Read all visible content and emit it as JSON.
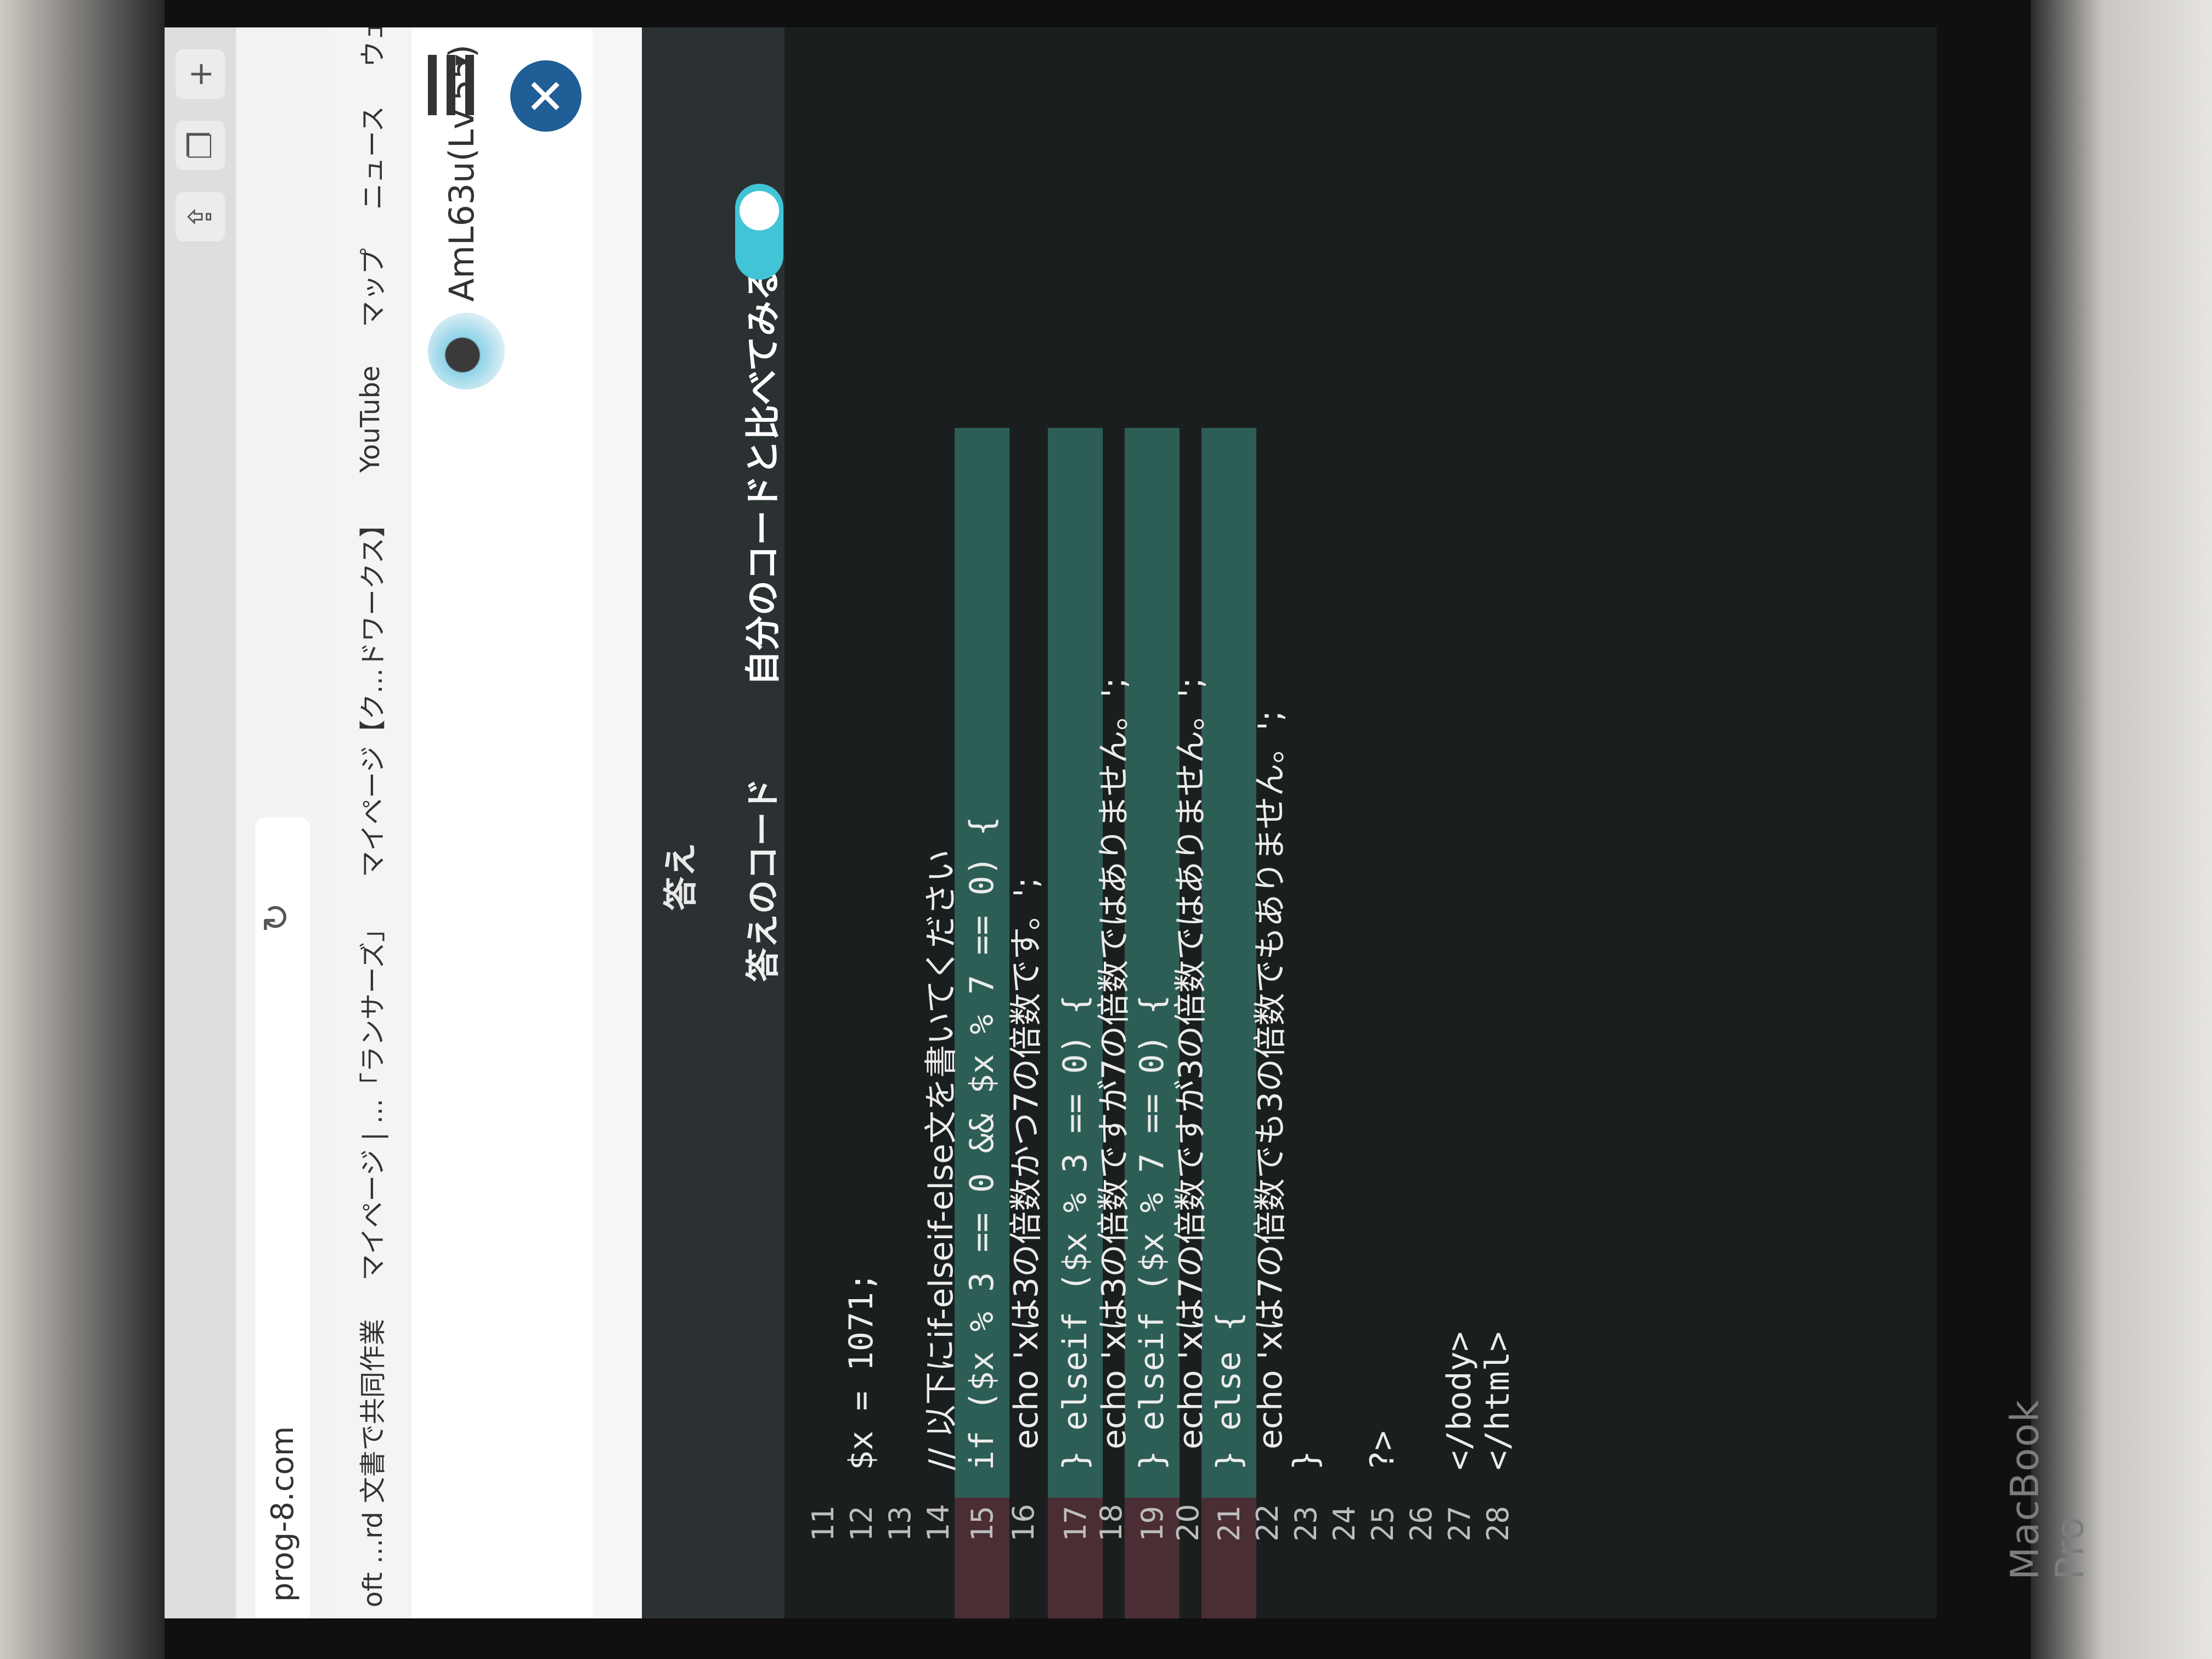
{
  "browser": {
    "url": "prog-8.com",
    "bookmarks": [
      "oft ...rd 文書で共同作業",
      "マイページ | ...「ランサーズ」",
      "マイページ【ク...ドワークス】",
      "YouTube",
      "マップ",
      "ニュース",
      "ウェブストア"
    ],
    "more_bookmarks": ">>",
    "new_tab": "+"
  },
  "header": {
    "user_name": "AmL63u(Lv.55)",
    "user_caret": "▾",
    "close_icon": "✕"
  },
  "modal": {
    "tab_label": "答え",
    "compare_label": "自分のコードと比べてみる",
    "compare_toggle_on": true,
    "code_title": "答えのコード"
  },
  "code": {
    "lines": [
      {
        "n": "11",
        "text": ""
      },
      {
        "n": "12",
        "text": "$x = 1071;"
      },
      {
        "n": "13",
        "text": ""
      },
      {
        "n": "14",
        "text": "// 以下にif-elseif-else文を書いてください"
      },
      {
        "n": "15",
        "text": "if ($x % 3 == 0 && $x % 7 == 0) {"
      },
      {
        "n": "16",
        "text": "  echo 'xは3の倍数かつ7の倍数です。';"
      },
      {
        "n": "17",
        "text": "} elseif ($x % 3 == 0) {"
      },
      {
        "n": "18",
        "text": "  echo 'xは3の倍数ですが7の倍数ではありません。';"
      },
      {
        "n": "19",
        "text": "} elseif ($x % 7 == 0) {"
      },
      {
        "n": "20",
        "text": "  echo 'xは7の倍数ですが3の倍数ではありません。';"
      },
      {
        "n": "21",
        "text": "} else {"
      },
      {
        "n": "22",
        "text": "  echo 'xは7の倍数でも3の倍数でもありません。';"
      },
      {
        "n": "23",
        "text": "}"
      },
      {
        "n": "24",
        "text": ""
      },
      {
        "n": "25",
        "text": "?>"
      },
      {
        "n": "26",
        "text": ""
      },
      {
        "n": "27",
        "text": "</body>"
      },
      {
        "n": "28",
        "text": "</html>"
      }
    ]
  },
  "device": {
    "brand": "MacBook Pro"
  },
  "colors": {
    "modal_bg": "#222728",
    "diff_added": "#2d5e55",
    "diff_removed": "#4a2e34",
    "highlight": "#35b89b",
    "toggle": "#41c5d6",
    "close_button": "#1f5e96"
  }
}
